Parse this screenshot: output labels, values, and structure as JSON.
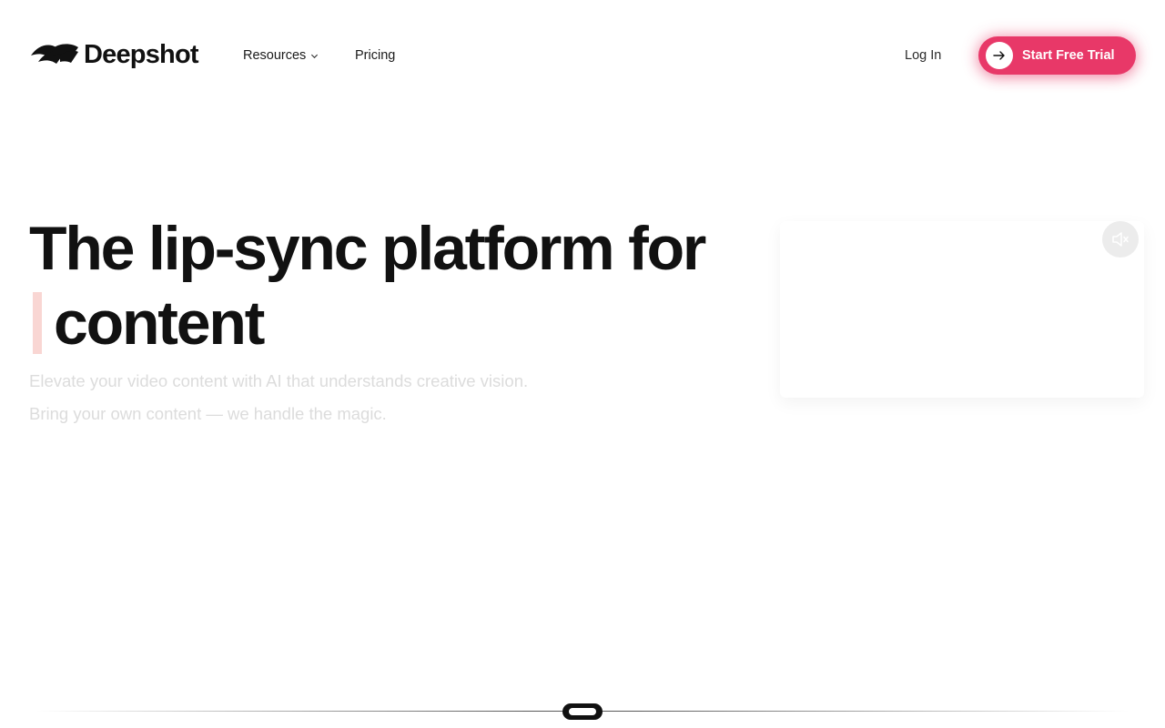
{
  "header": {
    "brand": "Deepshot",
    "brand_icon": "deepshot-logo-icon",
    "nav": {
      "resources_label": "Resources",
      "resources_icon": "chevron-down-icon",
      "pricing_label": "Pricing"
    },
    "login_label": "Log In",
    "cta": {
      "label": "Start Free Trial",
      "icon": "arrow-right-icon"
    }
  },
  "hero": {
    "headline_line1": "The lip-sync platform for",
    "headline_line2": "content",
    "subtitle_line1": "Elevate your video content with AI that understands creative vision.",
    "subtitle_line2": "Bring your own content — we handle the magic."
  },
  "video": {
    "mute_icon": "speaker-muted-icon"
  },
  "colors": {
    "accent": "#e83868",
    "caret": "#f9d6d3",
    "text": "#111111",
    "subtitle": "#dcdcdc"
  }
}
